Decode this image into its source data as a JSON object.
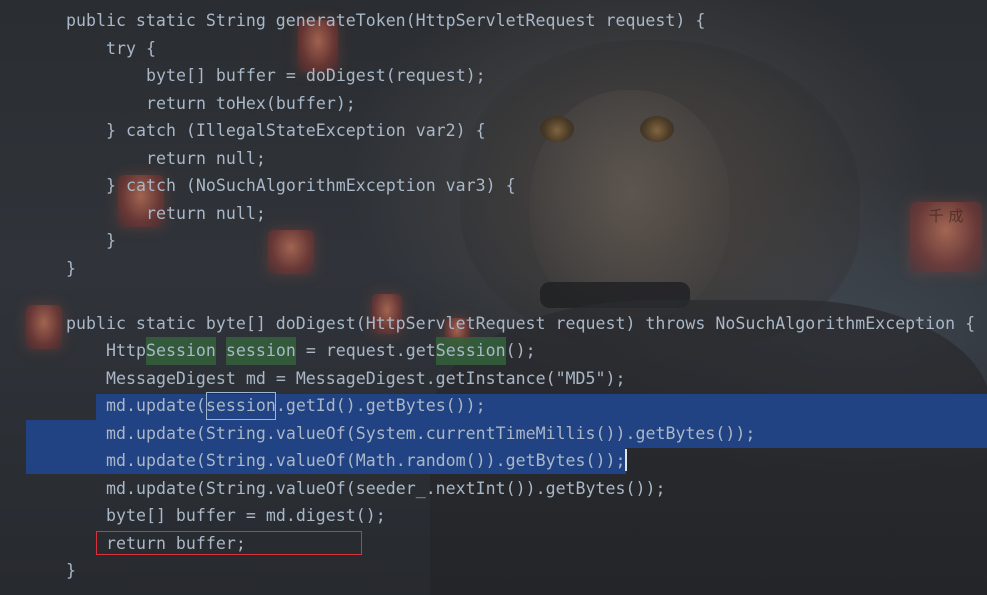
{
  "editor": {
    "lines": [
      {
        "indent": 1,
        "parts": [
          {
            "t": "public static String generateToken(HttpServletRequest request) {"
          }
        ]
      },
      {
        "indent": 2,
        "parts": [
          {
            "t": "try {"
          }
        ]
      },
      {
        "indent": 3,
        "parts": [
          {
            "t": "byte[] buffer = doDigest(request);"
          }
        ]
      },
      {
        "indent": 3,
        "parts": [
          {
            "t": "return toHex(buffer);"
          }
        ]
      },
      {
        "indent": 2,
        "parts": [
          {
            "t": "} catch (IllegalStateException var2) {"
          }
        ]
      },
      {
        "indent": 3,
        "parts": [
          {
            "t": "return null;"
          }
        ]
      },
      {
        "indent": 2,
        "parts": [
          {
            "t": "} catch (NoSuchAlgorithmException var3) {"
          }
        ]
      },
      {
        "indent": 3,
        "parts": [
          {
            "t": "return null;"
          }
        ]
      },
      {
        "indent": 2,
        "parts": [
          {
            "t": "}"
          }
        ]
      },
      {
        "indent": 1,
        "parts": [
          {
            "t": "}"
          }
        ]
      },
      {
        "indent": 0,
        "parts": [
          {
            "t": ""
          }
        ]
      },
      {
        "indent": 1,
        "parts": [
          {
            "t": "public static byte[] doDigest(HttpServletRequest request) throws NoSuchAlgorithmException {"
          }
        ]
      },
      {
        "indent": 2,
        "parts": [
          {
            "t": "Http"
          },
          {
            "t": "Session",
            "hl": "green"
          },
          {
            "t": " "
          },
          {
            "t": "session",
            "hl": "green"
          },
          {
            "t": " = request.get"
          },
          {
            "t": "Session",
            "hl": "green"
          },
          {
            "t": "();"
          }
        ]
      },
      {
        "indent": 2,
        "parts": [
          {
            "t": "MessageDigest md = MessageDigest.getInstance(\"MD5\");"
          }
        ]
      },
      {
        "indent": 2,
        "parts": [
          {
            "t": "md.update("
          },
          {
            "t": "session",
            "hl": "box"
          },
          {
            "t": ".getId().getBytes());"
          }
        ]
      },
      {
        "indent": 2,
        "parts": [
          {
            "t": "md.update(String.valueOf(System.currentTimeMillis()).getBytes());"
          }
        ]
      },
      {
        "indent": 2,
        "parts": [
          {
            "t": "md.update(String.valueOf(Math.random()).getBytes());"
          }
        ]
      },
      {
        "indent": 2,
        "parts": [
          {
            "t": "md.update(String.valueOf(seeder_.nextInt()).getBytes());"
          }
        ]
      },
      {
        "indent": 2,
        "parts": [
          {
            "t": "byte[] buffer = md.digest();"
          }
        ]
      },
      {
        "indent": 2,
        "parts": [
          {
            "t": "return buffer;"
          }
        ]
      },
      {
        "indent": 1,
        "parts": [
          {
            "t": "}"
          }
        ]
      }
    ]
  },
  "background": {
    "lantern_text": "千 成"
  },
  "colors": {
    "code_text": "#a9b7c6",
    "selection": "#214283",
    "match_highlight": "#34613b",
    "annotation_box": "#d9323a"
  }
}
